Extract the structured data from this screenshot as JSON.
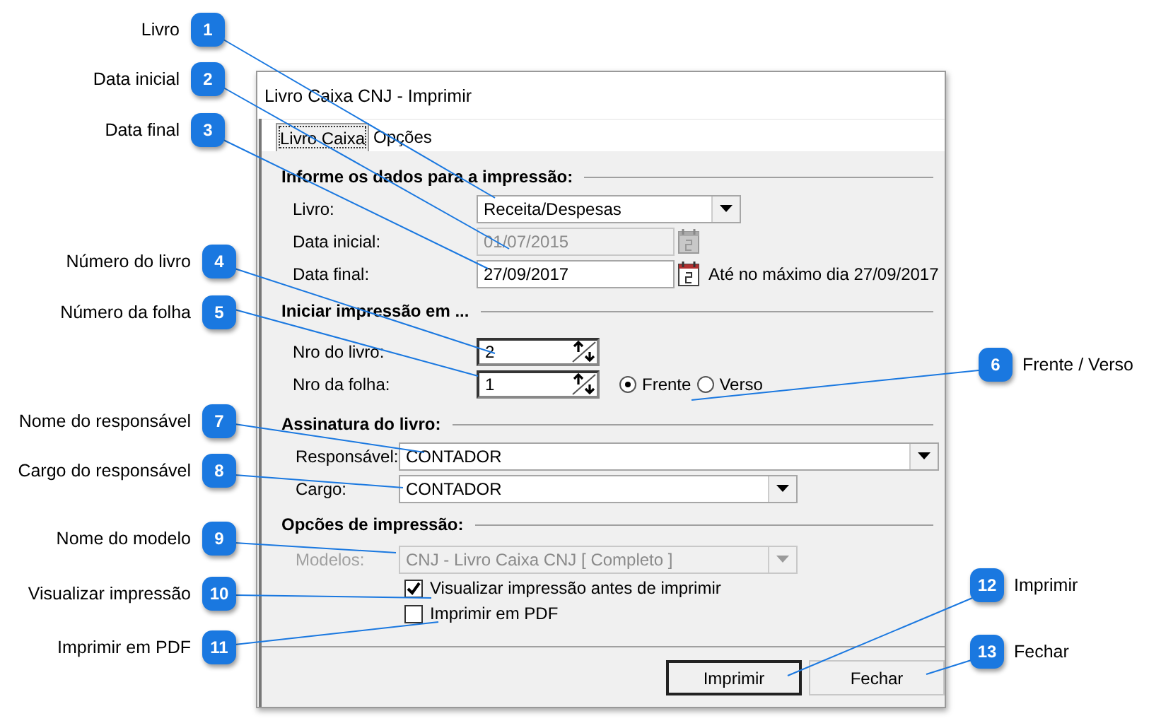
{
  "window": {
    "title": "Livro Caixa CNJ - Imprimir"
  },
  "tabs": [
    {
      "label": "Livro Caixa",
      "selected": true
    },
    {
      "label": "Opções",
      "selected": false
    }
  ],
  "sections": [
    {
      "title": "Informe os dados para a impressão:",
      "rows": [
        {
          "kind": "combo",
          "label": "Livro:",
          "value": "Receita/Despesas",
          "disabled": false
        },
        {
          "kind": "date",
          "label": "Data inicial:",
          "value": "01/07/2015",
          "disabled": true
        },
        {
          "kind": "date",
          "label": "Data final:",
          "value": "27/09/2017",
          "disabled": false,
          "note": "Até no máximo dia 27/09/2017"
        }
      ]
    },
    {
      "title": "Iniciar impressão em ...",
      "rows": [
        {
          "kind": "spin",
          "label": "Nro do livro:",
          "value": "2"
        },
        {
          "kind": "spin",
          "label": "Nro da folha:",
          "value": "1",
          "radios": [
            {
              "label": "Frente",
              "selected": true
            },
            {
              "label": "Verso",
              "selected": false
            }
          ]
        }
      ]
    },
    {
      "title": "Assinatura do livro:",
      "rows": [
        {
          "kind": "combo",
          "label": "Responsável:",
          "value": "CONTADOR",
          "disabled": false
        },
        {
          "kind": "combo",
          "label": "Cargo:",
          "value": "CONTADOR",
          "disabled": false
        }
      ]
    },
    {
      "title": "Opcões de impressão:",
      "rows": [
        {
          "kind": "combo",
          "label": "Modelos:",
          "value": "CNJ - Livro Caixa CNJ [ Completo ]",
          "disabled": true
        }
      ],
      "options": [
        {
          "label": "Visualizar impressão antes de imprimir",
          "checked": true
        },
        {
          "label": "Imprimir em PDF",
          "checked": false
        }
      ]
    }
  ],
  "buttons": [
    {
      "label": "Imprimir",
      "default": true
    },
    {
      "label": "Fechar",
      "default": false
    }
  ],
  "annotations": [
    {
      "number": "1",
      "label": "Livro"
    },
    {
      "number": "2",
      "label": "Data inicial"
    },
    {
      "number": "3",
      "label": "Data final"
    },
    {
      "number": "4",
      "label": "Número do livro"
    },
    {
      "number": "5",
      "label": "Número da folha"
    },
    {
      "number": "6",
      "label": "Frente / Verso"
    },
    {
      "number": "7",
      "label": "Nome do responsável"
    },
    {
      "number": "8",
      "label": "Cargo do responsável"
    },
    {
      "number": "9",
      "label": "Nome do modelo"
    },
    {
      "number": "10",
      "label": "Visualizar impressão"
    },
    {
      "number": "11",
      "label": "Imprimir em PDF"
    },
    {
      "number": "12",
      "label": "Imprimir"
    },
    {
      "number": "13",
      "label": "Fechar"
    }
  ]
}
